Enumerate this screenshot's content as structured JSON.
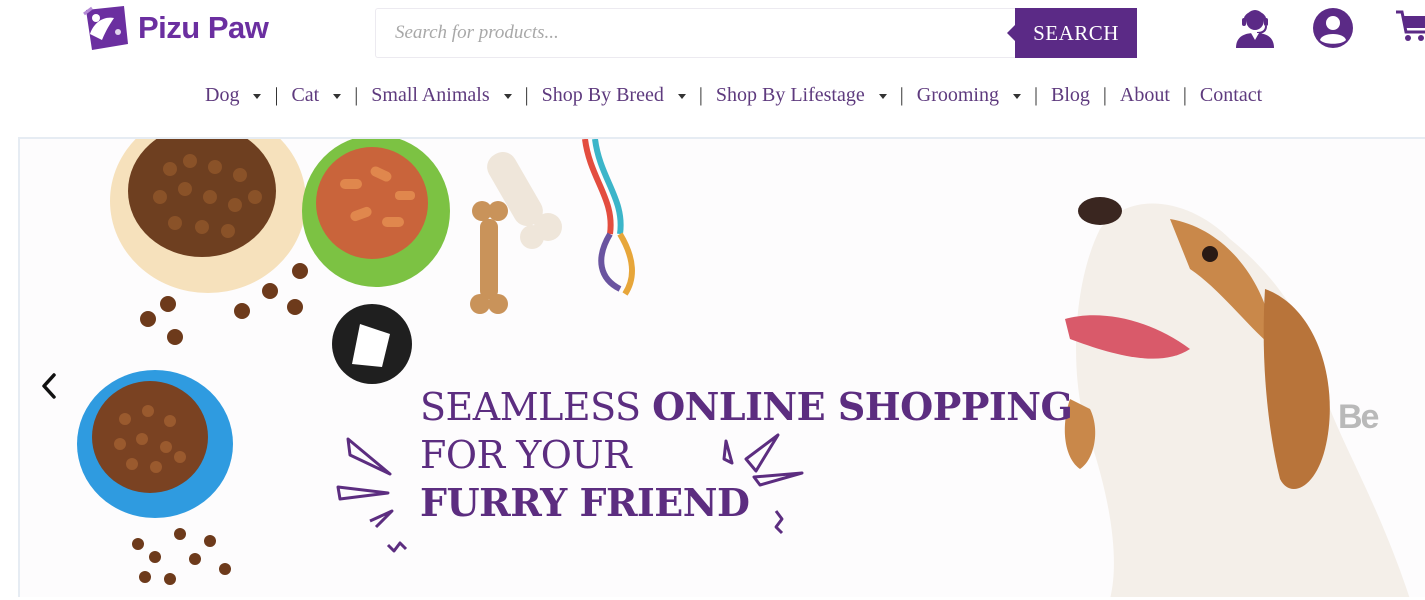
{
  "brand": {
    "name": "Pizu Paw",
    "logo_icon": "paw-tag-icon",
    "color": "#6b2fa0"
  },
  "search": {
    "placeholder": "Search for products...",
    "button_label": "SEARCH",
    "button_color": "#5b2a86"
  },
  "header_icons": [
    {
      "name": "customer-support-icon"
    },
    {
      "name": "account-icon"
    },
    {
      "name": "cart-icon"
    }
  ],
  "nav": {
    "items": [
      {
        "label": "Dog",
        "dropdown": true
      },
      {
        "label": "Cat",
        "dropdown": true
      },
      {
        "label": "Small Animals",
        "dropdown": true
      },
      {
        "label": "Shop By Breed",
        "dropdown": true
      },
      {
        "label": "Shop By Lifestage",
        "dropdown": true
      },
      {
        "label": "Grooming",
        "dropdown": true
      },
      {
        "label": "Blog",
        "dropdown": false
      },
      {
        "label": "About",
        "dropdown": false
      },
      {
        "label": "Contact",
        "dropdown": false
      }
    ],
    "separator": "|"
  },
  "hero": {
    "line1_light": "SEAMLESS ",
    "line1_bold": "ONLINE SHOPPING",
    "line2_light": "FOR YOUR",
    "line3_bold": "FURRY FRIEND",
    "text_color": "#5c2d80",
    "prev_icon": "chevron-left-icon"
  },
  "watermark": {
    "text": "Be"
  }
}
